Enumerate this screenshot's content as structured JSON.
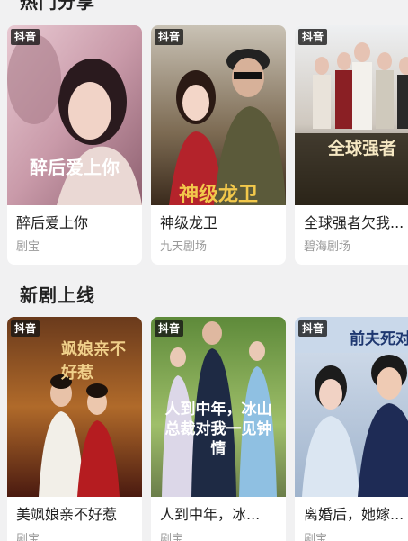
{
  "sections": [
    {
      "title": "热门分享",
      "items": [
        {
          "badge": "抖音",
          "poster_text": "醉后爱上你",
          "title": "醉后爱上你",
          "source": "剧宝"
        },
        {
          "badge": "抖音",
          "poster_text": "神级龙卫",
          "title": "神级龙卫",
          "source": "九天剧场"
        },
        {
          "badge": "抖音",
          "poster_text": "全球强者",
          "title": "全球强者欠我...",
          "source": "碧海剧场"
        }
      ]
    },
    {
      "title": "新剧上线",
      "items": [
        {
          "badge": "抖音",
          "poster_text": "飒娘亲不好惹",
          "title": "美飒娘亲不好惹",
          "source": "剧宝"
        },
        {
          "badge": "抖音",
          "poster_text": "人到中年，冰山总裁对我一见钟情",
          "title": "人到中年，冰...",
          "source": "剧宝"
        },
        {
          "badge": "抖音",
          "poster_text": "前夫死对头",
          "title": "离婚后，她嫁...",
          "source": "剧宝"
        }
      ]
    }
  ],
  "colors": {
    "background": "#f1f1f2",
    "card": "#ffffff",
    "source_text": "#9a9a9a"
  }
}
